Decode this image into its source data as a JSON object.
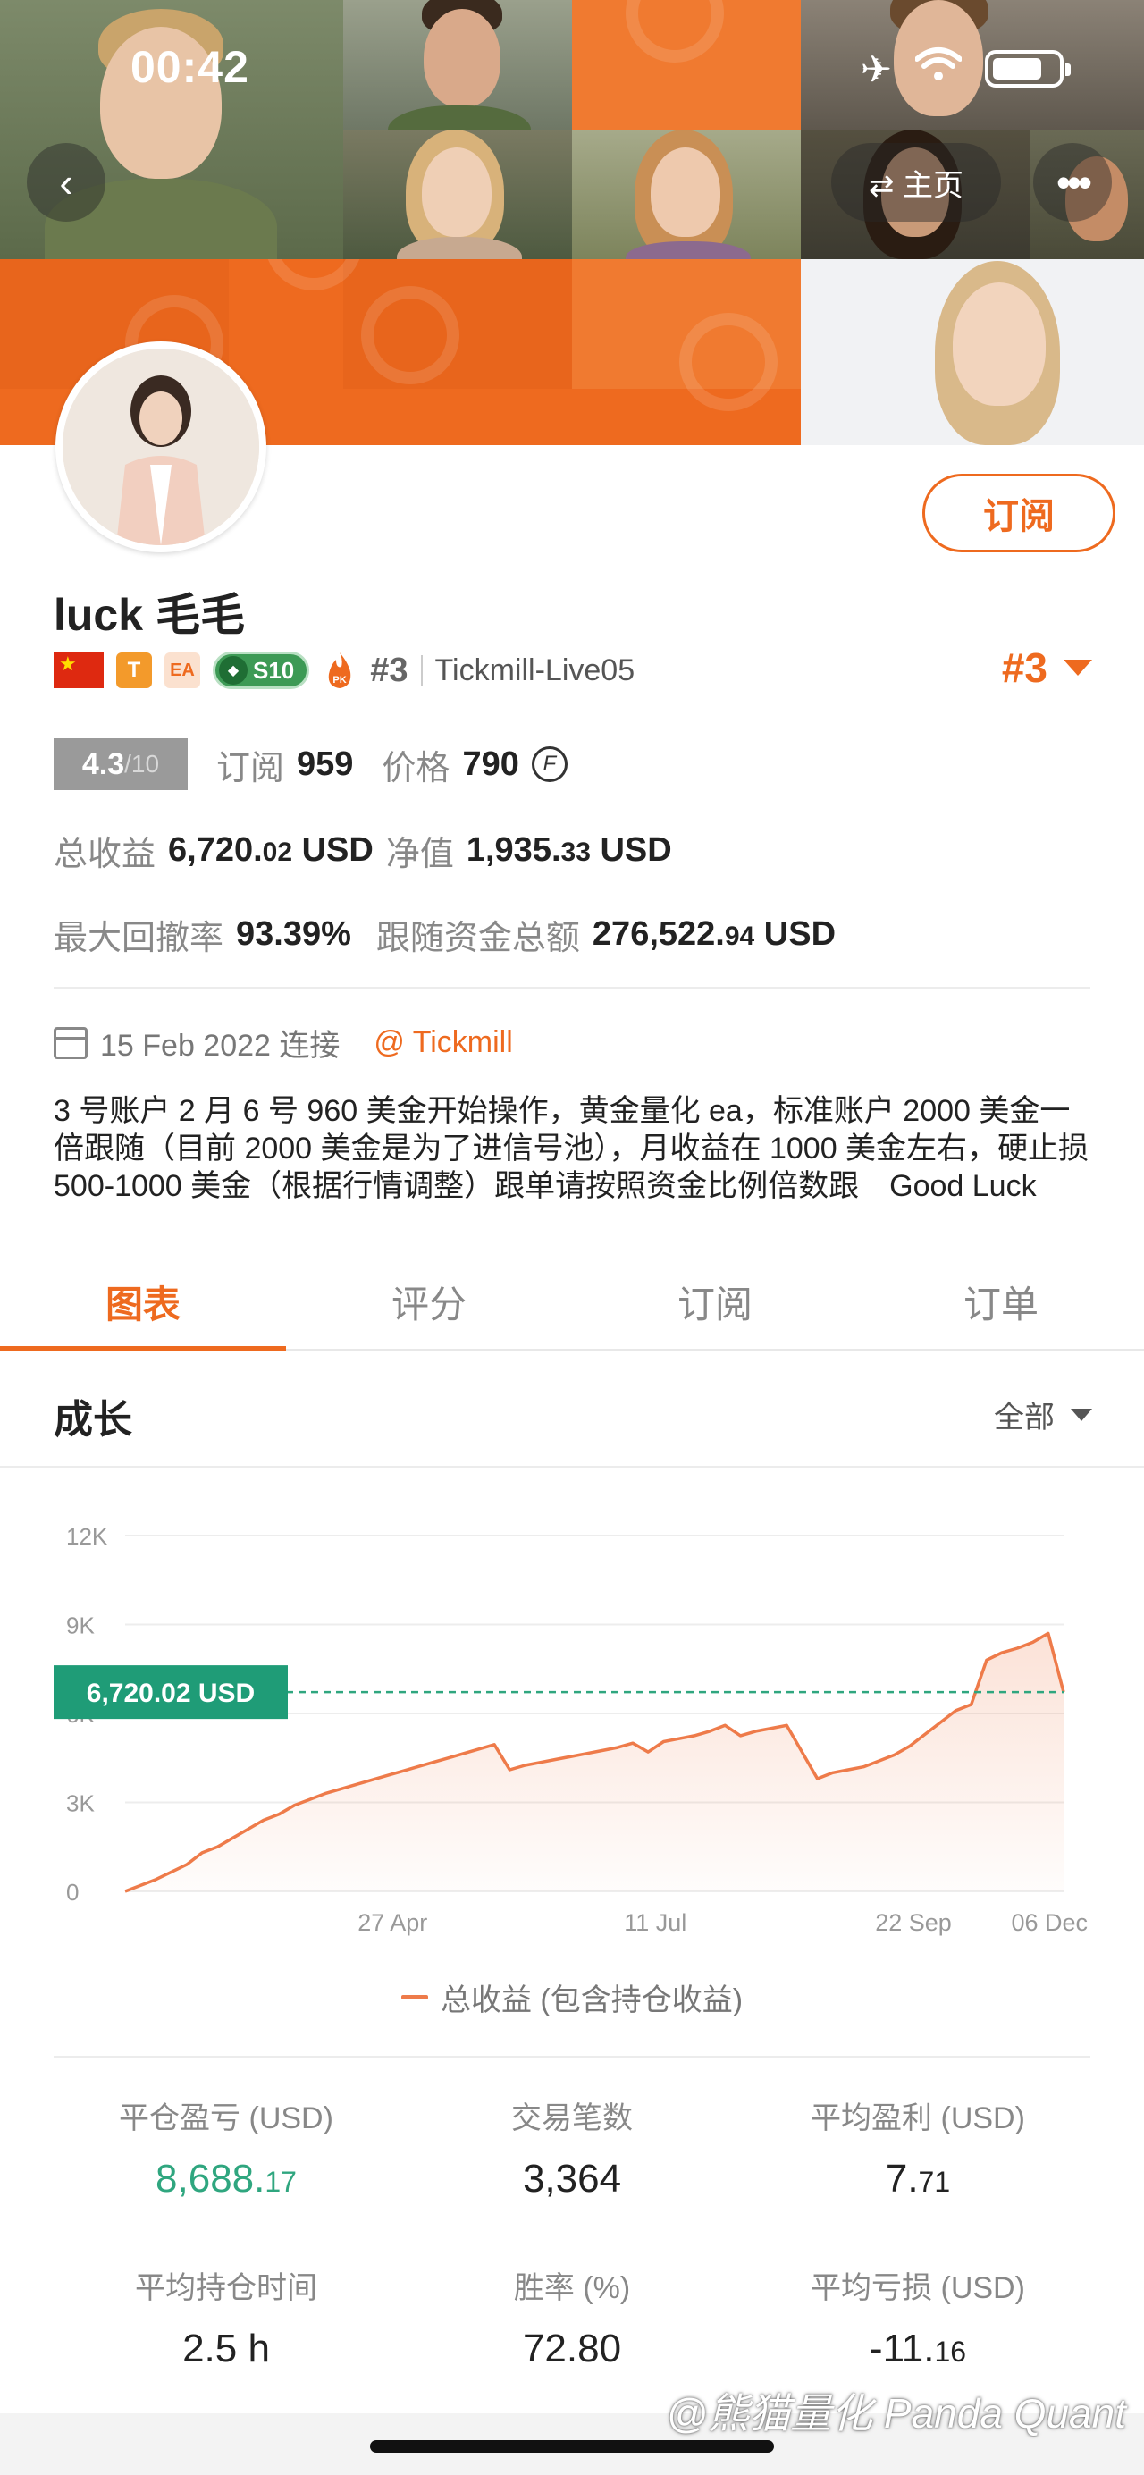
{
  "status_bar": {
    "time": "00:42"
  },
  "nav": {
    "home_label": "⇄ 主页"
  },
  "profile": {
    "subscribe_label": "订阅",
    "name": "luck 毛毛",
    "badges": {
      "t": "T",
      "ea": "EA",
      "season": "S10",
      "pk": "PK"
    },
    "rank_small": "#3",
    "server": "Tickmill-Live05",
    "rank_big": "#3",
    "score": "4.3",
    "score_den": "/10",
    "subscribers_label": "订阅",
    "subscribers": "959",
    "price_label": "价格",
    "price": "790",
    "coin_symbol": "F",
    "total_profit_label": "总收益",
    "total_profit_int": "6,720.",
    "total_profit_dec": "02",
    "total_profit_unit": "USD",
    "equity_label": "净值",
    "equity_int": "1,935.",
    "equity_dec": "33",
    "equity_unit": "USD",
    "max_drawdown_label": "最大回撤率",
    "max_drawdown": "93.39%",
    "follow_funds_label": "跟随资金总额",
    "follow_funds_int": "276,522.",
    "follow_funds_dec": "94",
    "follow_funds_unit": "USD",
    "connect_date": "15 Feb 2022 连接",
    "broker": "@ Tickmill",
    "description": "3 号账户 2 月 6 号 960 美金开始操作，黄金量化 ea，标准账户 2000 美金一倍跟随（目前 2000 美金是为了进信号池），月收益在 1000 美金左右，硬止损 500-1000 美金（根据行情调整）跟单请按照资金比例倍数跟　Good Luck"
  },
  "tabs": [
    {
      "label": "图表",
      "active": true
    },
    {
      "label": "评分",
      "active": false
    },
    {
      "label": "订阅",
      "active": false
    },
    {
      "label": "订单",
      "active": false
    }
  ],
  "section": {
    "title": "成长",
    "filter": "全部"
  },
  "chart_data": {
    "type": "area",
    "y_ticks": [
      "12K",
      "9K",
      "6K",
      "3K",
      "0"
    ],
    "x_ticks": [
      "27 Apr",
      "11 Jul",
      "22 Sep",
      "06 Dec"
    ],
    "ylim": [
      0,
      12000
    ],
    "current_value_label": "6,720.02 USD",
    "current_value": 6720.02,
    "series": [
      {
        "name": "总收益 (包含持仓收益)",
        "color": "#ee7b4a",
        "values": [
          0,
          200,
          400,
          650,
          900,
          1300,
          1500,
          1800,
          2100,
          2400,
          2600,
          2900,
          3100,
          3300,
          3450,
          3600,
          3750,
          3900,
          4050,
          4200,
          4350,
          4500,
          4650,
          4800,
          4950,
          4100,
          4250,
          4350,
          4450,
          4550,
          4650,
          4750,
          4850,
          5000,
          4700,
          5050,
          5150,
          5250,
          5400,
          5600,
          5250,
          5400,
          5500,
          5600,
          4700,
          3800,
          4000,
          4100,
          4200,
          4400,
          4600,
          4900,
          5300,
          5700,
          6100,
          6300,
          7800,
          8050,
          8200,
          8400,
          8700,
          6720
        ]
      }
    ],
    "legend_label": "总收益 (包含持仓收益)"
  },
  "stats": [
    {
      "label": "平仓盈亏 (USD)",
      "int": "8,688.",
      "dec": "17",
      "green": true
    },
    {
      "label": "交易笔数",
      "int": "3,364",
      "dec": "",
      "green": false
    },
    {
      "label": "平均盈利 (USD)",
      "int": "7.",
      "dec": "71",
      "green": false
    },
    {
      "label": "平均持仓时间",
      "int": "2.5 h",
      "dec": "",
      "green": false
    },
    {
      "label": "胜率 (%)",
      "int": "72.80",
      "dec": "",
      "green": false
    },
    {
      "label": "平均亏损 (USD)",
      "int": "-11.",
      "dec": "16",
      "green": false
    }
  ],
  "watermark": "@熊猫量化 Panda Quant",
  "colors": {
    "accent": "#ee6a1f",
    "green": "#2fa67f",
    "teal_label": "#1f9c77"
  }
}
